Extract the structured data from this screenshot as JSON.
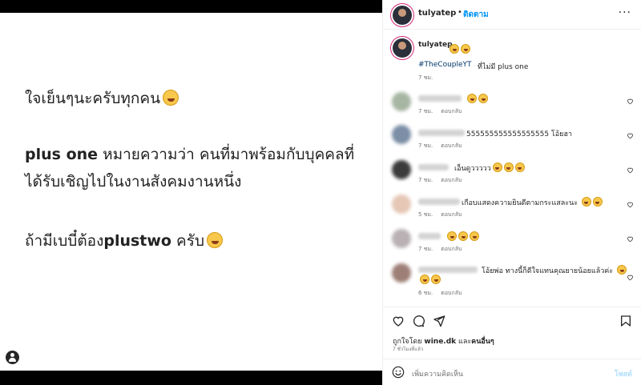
{
  "post_image": {
    "line1": "ใจเย็นๆนะครับทุกคน",
    "line2_bold": "plus one",
    "line2_rest": " หมายความว่า คนที่มาพร้อมกับบุคคลที่",
    "line3": "ได้รับเชิญไปในงานสังคมงานหนึ่ง",
    "line4": "ถ้ามีเบบี๋ต้อง",
    "line4_bold": "plustwo",
    "line4_end": " ครับ"
  },
  "header": {
    "username": "tulyatep",
    "dot": "•",
    "follow_label": "ติดตาม",
    "more": "···"
  },
  "caption": {
    "username": "tulyatep",
    "hashtag": "#TheCoupleYT",
    "text": "ที่ไม่มี plus one",
    "time": "7 ชม."
  },
  "comments": [
    {
      "text": "",
      "time": "7 ชม.",
      "reply": "ตอบกลับ"
    },
    {
      "text": "555555555555555555 โอ้ยฮา",
      "time": "7 ชม.",
      "reply": "ตอบกลับ"
    },
    {
      "text": "เอ็นดูววววว",
      "time": "7 ชม.",
      "reply": "ตอบกลับ"
    },
    {
      "text": "เกือบแสดงความยินดีตามกระแสละนะ",
      "time": "5 ชม.",
      "reply": "ตอบกลับ"
    },
    {
      "text": "",
      "time": "7 ชม.",
      "reply": "ตอบกลับ"
    },
    {
      "text": "โอ้ยพ่อ ทางนี้ก็ดีใจแทนคุณยายน้อยแล้วค่ะ",
      "time": "6 ชม.",
      "reply": "ตอบกลับ"
    }
  ],
  "likes": {
    "prefix": "ถูกใจโดย ",
    "user": "wine.dk",
    "middle": " และ",
    "others": "คนอื่นๆ"
  },
  "time_ago": "7 ชั่วโมงที่แล้ว",
  "composer": {
    "placeholder": "เพิ่มความคิดเห็น",
    "post_label": "โพสต์"
  },
  "colors": {
    "accent": "#0095f6",
    "hashtag": "#00376b",
    "muted": "#737373"
  }
}
